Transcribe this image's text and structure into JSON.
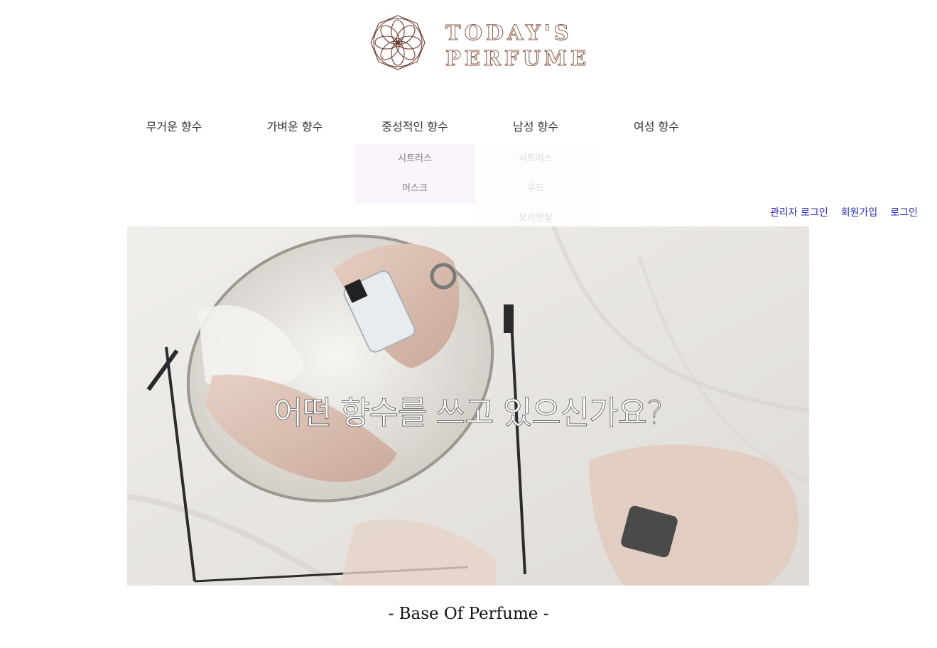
{
  "brand": {
    "name_line1": "TODAY'S",
    "name_line2": "PERFUME",
    "color": "#8a5a48"
  },
  "nav": {
    "items": [
      {
        "label": "무거운 향수"
      },
      {
        "label": "가벼운 향수"
      },
      {
        "label": "중성적인 향수"
      },
      {
        "label": "남성 향수"
      },
      {
        "label": "여성 향수"
      }
    ],
    "dropdown_neutral": [
      "시트러스",
      "머스크"
    ],
    "dropdown_male": [
      "시트러스",
      "우드",
      "오리엔탈"
    ]
  },
  "auth": {
    "admin_login": "관리자 로그인",
    "signup": "회원가입",
    "login": "로그인"
  },
  "hero": {
    "headline": "어떤 향수를 쓰고 있으신가요?"
  },
  "section": {
    "title": "- Base Of Perfume -"
  },
  "colors": {
    "link": "#2a2ab8",
    "dropdown_bg": "#faf5fd"
  }
}
